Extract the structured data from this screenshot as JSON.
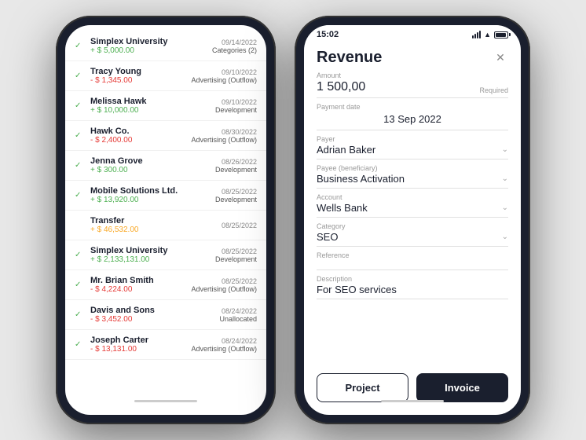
{
  "left_phone": {
    "transactions": [
      {
        "checked": true,
        "name": "Simplex University",
        "amount": "+ $ 5,000.00",
        "amount_type": "positive",
        "date": "09/14/2022",
        "category": "Categories (2)"
      },
      {
        "checked": true,
        "name": "Tracy Young",
        "amount": "- $ 1,345.00",
        "amount_type": "negative",
        "date": "09/10/2022",
        "category": "Advertising (Outflow)"
      },
      {
        "checked": true,
        "name": "Melissa Hawk",
        "amount": "+ $ 10,000.00",
        "amount_type": "positive",
        "date": "09/10/2022",
        "category": "Development"
      },
      {
        "checked": true,
        "name": "Hawk Co.",
        "amount": "- $ 2,400.00",
        "amount_type": "negative",
        "date": "08/30/2022",
        "category": "Advertising (Outflow)"
      },
      {
        "checked": true,
        "name": "Jenna Grove",
        "amount": "+ $ 300.00",
        "amount_type": "positive",
        "date": "08/26/2022",
        "category": "Development"
      },
      {
        "checked": true,
        "name": "Mobile Solutions Ltd.",
        "amount": "+ $ 13,920.00",
        "amount_type": "positive",
        "date": "08/25/2022",
        "category": "Development"
      },
      {
        "checked": false,
        "name": "Transfer",
        "amount": "+ $ 46,532.00",
        "amount_type": "yellow",
        "date": "08/25/2022",
        "category": ""
      },
      {
        "checked": true,
        "name": "Simplex University",
        "amount": "+ $ 2,133,131.00",
        "amount_type": "positive",
        "date": "08/25/2022",
        "category": "Development"
      },
      {
        "checked": true,
        "name": "Mr. Brian Smith",
        "amount": "- $ 4,224.00",
        "amount_type": "negative",
        "date": "08/25/2022",
        "category": "Advertising (Outflow)"
      },
      {
        "checked": true,
        "name": "Davis and Sons",
        "amount": "- $ 3,452.00",
        "amount_type": "negative",
        "date": "08/24/2022",
        "category": "Unallocated"
      },
      {
        "checked": true,
        "name": "Joseph Carter",
        "amount": "- $ 13,131.00",
        "amount_type": "negative",
        "date": "08/24/2022",
        "category": "Advertising (Outflow)"
      }
    ]
  },
  "right_phone": {
    "status_time": "15:02",
    "form_title": "Revenue",
    "fields": {
      "amount_label": "Amount",
      "amount_value": "1 500,00",
      "amount_required": "Required",
      "payment_date_label": "Payment date",
      "payment_date_value": "13 Sep 2022",
      "payer_label": "Payer",
      "payer_value": "Adrian Baker",
      "payee_label": "Payee (beneficiary)",
      "payee_value": "Business Activation",
      "account_label": "Account",
      "account_value": "Wells Bank",
      "category_label": "Category",
      "category_value": "SEO",
      "reference_label": "Reference",
      "reference_value": "",
      "description_label": "Description",
      "description_value": "For SEO services"
    },
    "buttons": {
      "project": "Project",
      "invoice": "Invoice"
    }
  }
}
